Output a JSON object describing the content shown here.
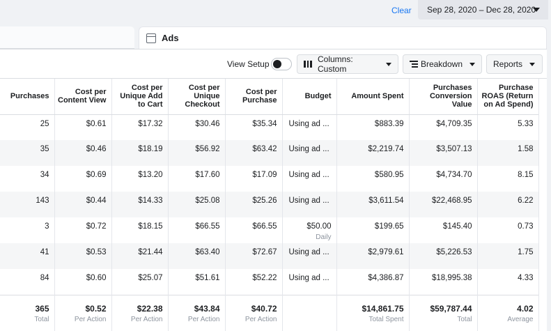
{
  "topbar": {
    "clear_label": "Clear",
    "date_range": "Sep 28, 2020 – Dec 28, 2020"
  },
  "tab": {
    "label": "Ads"
  },
  "toolbar": {
    "view_setup_label": "View Setup",
    "view_setup_on": false,
    "columns_label": "Columns: Custom",
    "breakdown_label": "Breakdown",
    "reports_label": "Reports"
  },
  "table": {
    "headers": [
      "Purchases",
      "Cost per Content View",
      "Cost per Unique Add to Cart",
      "Cost per Unique Checkout",
      "Cost per Purchase",
      "Budget",
      "Amount Spent",
      "Purchases Conversion Value",
      "Purchase ROAS (Return on Ad Spend)"
    ],
    "rows": [
      {
        "purchases": "25",
        "cpcv": "$0.61",
        "cpuatc": "$17.32",
        "cpuc": "$30.46",
        "cpp": "$35.34",
        "budget": "Using ad ...",
        "budget_sub": "",
        "spent": "$883.39",
        "value": "$4,709.35",
        "roas": "5.33"
      },
      {
        "purchases": "35",
        "cpcv": "$0.46",
        "cpuatc": "$18.19",
        "cpuc": "$56.92",
        "cpp": "$63.42",
        "budget": "Using ad ...",
        "budget_sub": "",
        "spent": "$2,219.74",
        "value": "$3,507.13",
        "roas": "1.58"
      },
      {
        "purchases": "34",
        "cpcv": "$0.69",
        "cpuatc": "$13.20",
        "cpuc": "$17.60",
        "cpp": "$17.09",
        "budget": "Using ad ...",
        "budget_sub": "",
        "spent": "$580.95",
        "value": "$4,734.70",
        "roas": "8.15"
      },
      {
        "purchases": "143",
        "cpcv": "$0.44",
        "cpuatc": "$14.33",
        "cpuc": "$25.08",
        "cpp": "$25.26",
        "budget": "Using ad ...",
        "budget_sub": "",
        "spent": "$3,611.54",
        "value": "$22,468.95",
        "roas": "6.22"
      },
      {
        "purchases": "3",
        "cpcv": "$0.72",
        "cpuatc": "$18.15",
        "cpuc": "$66.55",
        "cpp": "$66.55",
        "budget": "$50.00",
        "budget_sub": "Daily",
        "spent": "$199.65",
        "value": "$145.40",
        "roas": "0.73"
      },
      {
        "purchases": "41",
        "cpcv": "$0.53",
        "cpuatc": "$21.44",
        "cpuc": "$63.40",
        "cpp": "$72.67",
        "budget": "Using ad ...",
        "budget_sub": "",
        "spent": "$2,979.61",
        "value": "$5,226.53",
        "roas": "1.75"
      },
      {
        "purchases": "84",
        "cpcv": "$0.60",
        "cpuatc": "$25.07",
        "cpuc": "$51.61",
        "cpp": "$52.22",
        "budget": "Using ad ...",
        "budget_sub": "",
        "spent": "$4,386.87",
        "value": "$18,995.38",
        "roas": "4.33"
      }
    ],
    "totals": {
      "purchases": "365",
      "purchases_sub": "Total",
      "cpcv": "$0.52",
      "cpcv_sub": "Per Action",
      "cpuatc": "$22.38",
      "cpuatc_sub": "Per Action",
      "cpuc": "$43.84",
      "cpuc_sub": "Per Action",
      "cpp": "$40.72",
      "cpp_sub": "Per Action",
      "spent": "$14,861.75",
      "spent_sub": "Total Spent",
      "value": "$59,787.44",
      "value_sub": "Total",
      "roas": "4.02",
      "roas_sub": "Average"
    }
  }
}
